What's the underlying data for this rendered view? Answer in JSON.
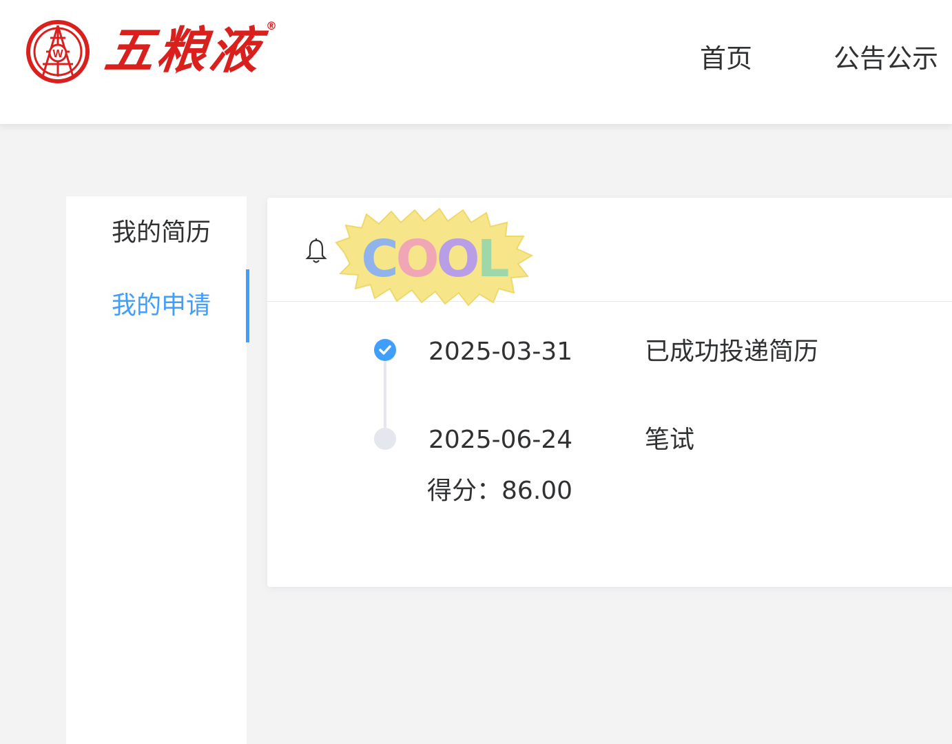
{
  "header": {
    "logo_text": "五粮液",
    "logo_registered": "®",
    "nav": [
      {
        "label": "首页"
      },
      {
        "label": "公告公示"
      }
    ]
  },
  "sidebar": {
    "items": [
      {
        "label": "我的简历",
        "active": false
      },
      {
        "label": "我的申请",
        "active": true
      }
    ]
  },
  "card": {
    "sticker_text": "COOL",
    "timeline": [
      {
        "date": "2025-03-31",
        "status": "已成功投递简历",
        "done": true
      },
      {
        "date": "2025-06-24",
        "status": "笔试",
        "done": false,
        "score_label": "得分：",
        "score_value": "86.00"
      }
    ]
  },
  "colors": {
    "brand_red": "#d9201d",
    "accent_blue": "#409eff",
    "text_primary": "#303133",
    "pending_gray": "#e4e7ed",
    "page_bg": "#f3f3f4"
  }
}
